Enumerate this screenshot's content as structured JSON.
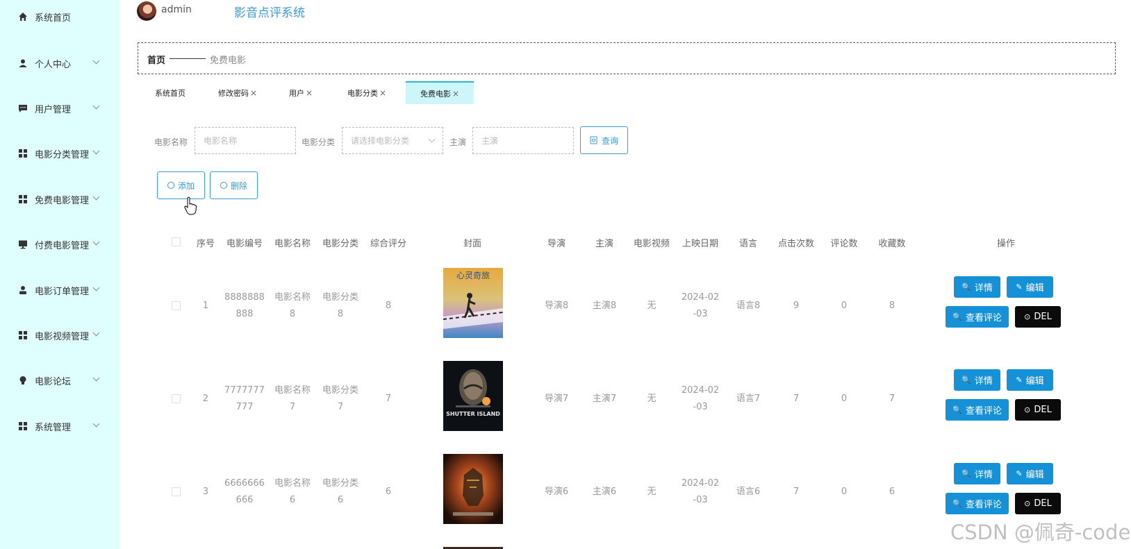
{
  "sidebar": {
    "items": [
      {
        "label": "系统首页",
        "icon": "home-icon",
        "expandable": false
      },
      {
        "label": "个人中心",
        "icon": "user-icon",
        "expandable": true
      },
      {
        "label": "用户管理",
        "icon": "chat-icon",
        "expandable": true
      },
      {
        "label": "电影分类管理",
        "icon": "grid-icon",
        "expandable": true
      },
      {
        "label": "免费电影管理",
        "icon": "grid-icon",
        "expandable": true
      },
      {
        "label": "付费电影管理",
        "icon": "monitor-icon",
        "expandable": true
      },
      {
        "label": "电影订单管理",
        "icon": "person-icon",
        "expandable": true
      },
      {
        "label": "电影视频管理",
        "icon": "grid-icon",
        "expandable": true
      },
      {
        "label": "电影论坛",
        "icon": "bulb-icon",
        "expandable": true
      },
      {
        "label": "系统管理",
        "icon": "grid-icon",
        "expandable": true
      }
    ]
  },
  "header": {
    "username": "admin",
    "app_title": "影音点评系统"
  },
  "breadcrumb": {
    "home": "首页",
    "current": "免费电影"
  },
  "tabs": [
    {
      "label": "系统首页",
      "closable": false
    },
    {
      "label": "修改密码",
      "closable": true
    },
    {
      "label": "用户",
      "closable": true
    },
    {
      "label": "电影分类",
      "closable": true
    },
    {
      "label": "免费电影",
      "closable": true,
      "active": true
    }
  ],
  "search": {
    "name_label": "电影名称",
    "name_placeholder": "电影名称",
    "category_label": "电影分类",
    "category_placeholder": "请选择电影分类",
    "actor_label": "主演",
    "actor_placeholder": "主演",
    "query_button": "查询"
  },
  "toolbar": {
    "add_label": "添加",
    "delete_label": "删除"
  },
  "table": {
    "columns": [
      "序号",
      "电影编号",
      "电影名称",
      "电影分类",
      "综合评分",
      "封面",
      "导演",
      "主演",
      "电影视频",
      "上映日期",
      "语言",
      "点击次数",
      "评论数",
      "收藏数",
      "操作"
    ],
    "rows": [
      {
        "index": "1",
        "code_l1": "8888888",
        "code_l2": "888",
        "name_l1": "电影名称",
        "name_l2": "8",
        "cat_l1": "电影分类",
        "cat_l2": "8",
        "score": "8",
        "director": "导演8",
        "actor": "主演8",
        "video": "无",
        "date_l1": "2024-02",
        "date_l2": "-03",
        "language": "语言8",
        "clicks": "9",
        "comments": "0",
        "favorites": "8"
      },
      {
        "index": "2",
        "code_l1": "7777777",
        "code_l2": "777",
        "name_l1": "电影名称",
        "name_l2": "7",
        "cat_l1": "电影分类",
        "cat_l2": "7",
        "score": "7",
        "director": "导演7",
        "actor": "主演7",
        "video": "无",
        "date_l1": "2024-02",
        "date_l2": "-03",
        "language": "语言7",
        "clicks": "7",
        "comments": "0",
        "favorites": "7"
      },
      {
        "index": "3",
        "code_l1": "6666666",
        "code_l2": "666",
        "name_l1": "电影名称",
        "name_l2": "6",
        "cat_l1": "电影分类",
        "cat_l2": "6",
        "score": "6",
        "director": "导演6",
        "actor": "主演6",
        "video": "无",
        "date_l1": "2024-02",
        "date_l2": "-03",
        "language": "语言6",
        "clicks": "7",
        "comments": "0",
        "favorites": "6"
      }
    ],
    "actions": {
      "detail": "详情",
      "edit": "编辑",
      "comments": "查看评论",
      "del": "DEL"
    }
  },
  "watermark": "CSDN @佩奇-code",
  "colors": {
    "sidebar_bg": "#dffffe",
    "accent": "#3a9bd5",
    "action_blue": "#1591d8",
    "del_black": "#0b0b0b",
    "active_tab": "#cdf6fb"
  }
}
